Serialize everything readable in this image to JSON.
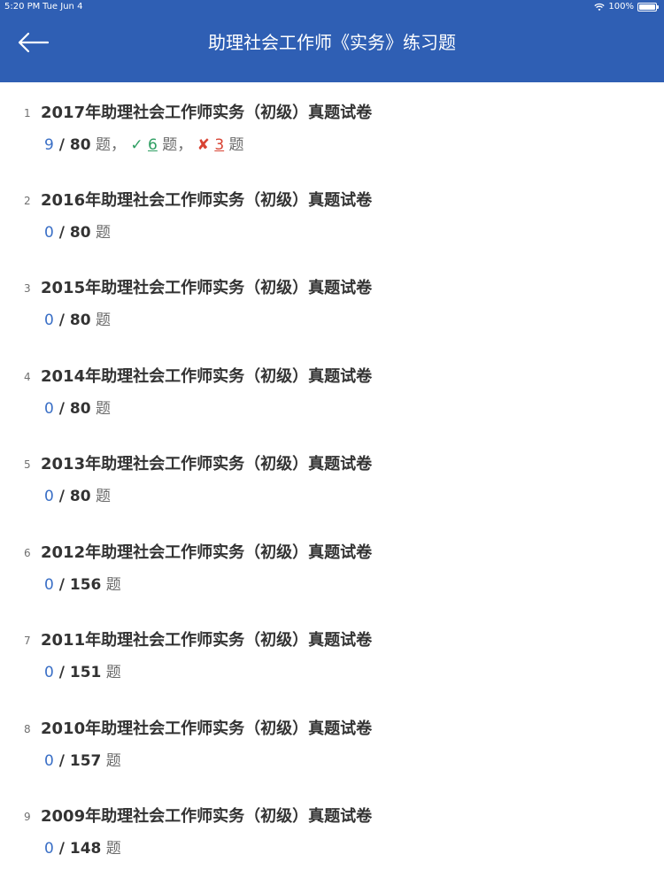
{
  "status_bar": {
    "time": "5:20 PM",
    "date": "Tue Jun 4",
    "battery": "100%",
    "battery_level": 100
  },
  "header": {
    "title": "助理社会工作师《实务》练习题",
    "back_icon": "back-arrow-icon",
    "background": "#2f5fb4"
  },
  "items": [
    {
      "index": "1",
      "title": "2017年助理社会工作师实务（初级）真题试卷",
      "done": "9",
      "sep": " / ",
      "total": "80",
      "unit": " 题",
      "correct_mark": "✓",
      "correct": "6",
      "correct_unit": " 题",
      "comma": "，",
      "wrong_mark": "✘",
      "wrong": "3",
      "wrong_unit": " 题"
    },
    {
      "index": "2",
      "title": "2016年助理社会工作师实务（初级）真题试卷",
      "done": "0",
      "sep": " / ",
      "total": "80",
      "unit": " 题"
    },
    {
      "index": "3",
      "title": "2015年助理社会工作师实务（初级）真题试卷",
      "done": "0",
      "sep": " / ",
      "total": "80",
      "unit": " 题"
    },
    {
      "index": "4",
      "title": "2014年助理社会工作师实务（初级）真题试卷",
      "done": "0",
      "sep": " / ",
      "total": "80",
      "unit": " 题"
    },
    {
      "index": "5",
      "title": "2013年助理社会工作师实务（初级）真题试卷",
      "done": "0",
      "sep": " / ",
      "total": "80",
      "unit": " 题"
    },
    {
      "index": "6",
      "title": "2012年助理社会工作师实务（初级）真题试卷",
      "done": "0",
      "sep": " / ",
      "total": "156",
      "unit": " 题"
    },
    {
      "index": "7",
      "title": "2011年助理社会工作师实务（初级）真题试卷",
      "done": "0",
      "sep": " / ",
      "total": "151",
      "unit": " 题"
    },
    {
      "index": "8",
      "title": "2010年助理社会工作师实务（初级）真题试卷",
      "done": "0",
      "sep": " / ",
      "total": "157",
      "unit": " 题"
    },
    {
      "index": "9",
      "title": "2009年助理社会工作师实务（初级）真题试卷",
      "done": "0",
      "sep": " / ",
      "total": "148",
      "unit": " 题"
    }
  ],
  "colors": {
    "accent": "#2f5fb4",
    "progress": "#3a6fc6",
    "correct": "#2e9e62",
    "wrong": "#d84333"
  }
}
